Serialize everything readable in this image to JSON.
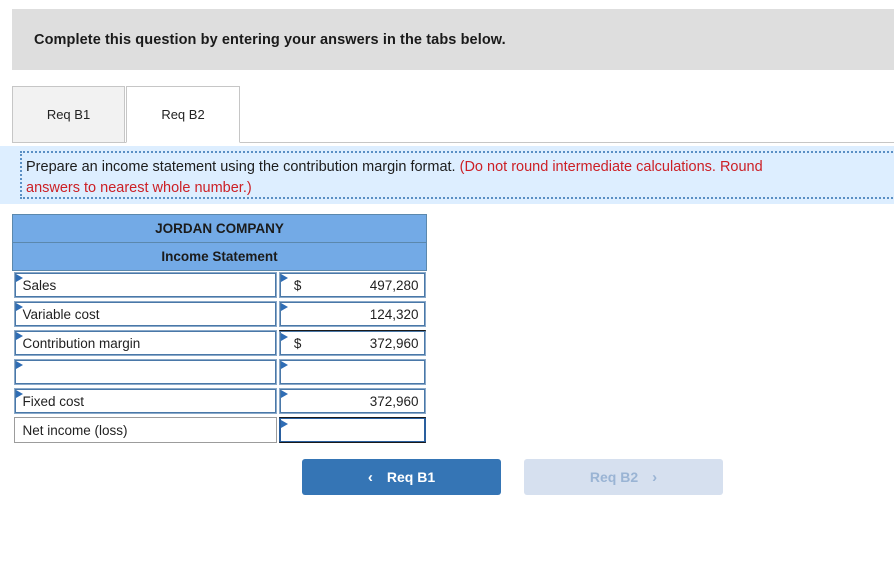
{
  "banner": {
    "text": "Complete this question by entering your answers in the tabs below."
  },
  "tabs": [
    {
      "label": "Req B1",
      "active": false
    },
    {
      "label": "Req B2",
      "active": true
    }
  ],
  "instruction": {
    "line1_plain": "Prepare an income statement using the contribution margin format. ",
    "line1_red": "(Do not round intermediate calculations. Round",
    "line2_red": "answers to nearest whole number.)"
  },
  "statement": {
    "company": "JORDAN COMPANY",
    "title": "Income Statement",
    "rows": [
      {
        "label": "Sales",
        "currency": "$",
        "value": "497,280",
        "label_input": true,
        "value_input": true,
        "rule_top": false,
        "focused": false,
        "blank": false
      },
      {
        "label": "Variable cost",
        "currency": "",
        "value": "124,320",
        "label_input": true,
        "value_input": true,
        "rule_top": false,
        "focused": false,
        "blank": false
      },
      {
        "label": "Contribution margin",
        "currency": "$",
        "value": "372,960",
        "label_input": true,
        "value_input": true,
        "rule_top": true,
        "focused": false,
        "blank": false
      },
      {
        "label": "",
        "currency": "",
        "value": "",
        "label_input": true,
        "value_input": true,
        "rule_top": false,
        "focused": false,
        "blank": true
      },
      {
        "label": "Fixed cost",
        "currency": "",
        "value": "372,960",
        "label_input": true,
        "value_input": true,
        "rule_top": false,
        "focused": false,
        "blank": false
      },
      {
        "label": "Net income (loss)",
        "currency": "",
        "value": "",
        "label_input": false,
        "value_input": true,
        "rule_top": true,
        "focused": true,
        "blank": false
      }
    ]
  },
  "nav": {
    "prev_label": "Req B1",
    "prev_icon": "chevron-left-icon",
    "prev_chevron": "‹",
    "next_label": "Req B2",
    "next_icon": "chevron-right-icon",
    "next_chevron": "›"
  },
  "colors": {
    "banner_bg": "#dedede",
    "instruction_bg": "#ddeeff",
    "table_header_bg": "#73aae6",
    "accent_blue": "#3575b5",
    "disabled_blue": "#d6e0ef",
    "red_text": "#cc2026"
  }
}
